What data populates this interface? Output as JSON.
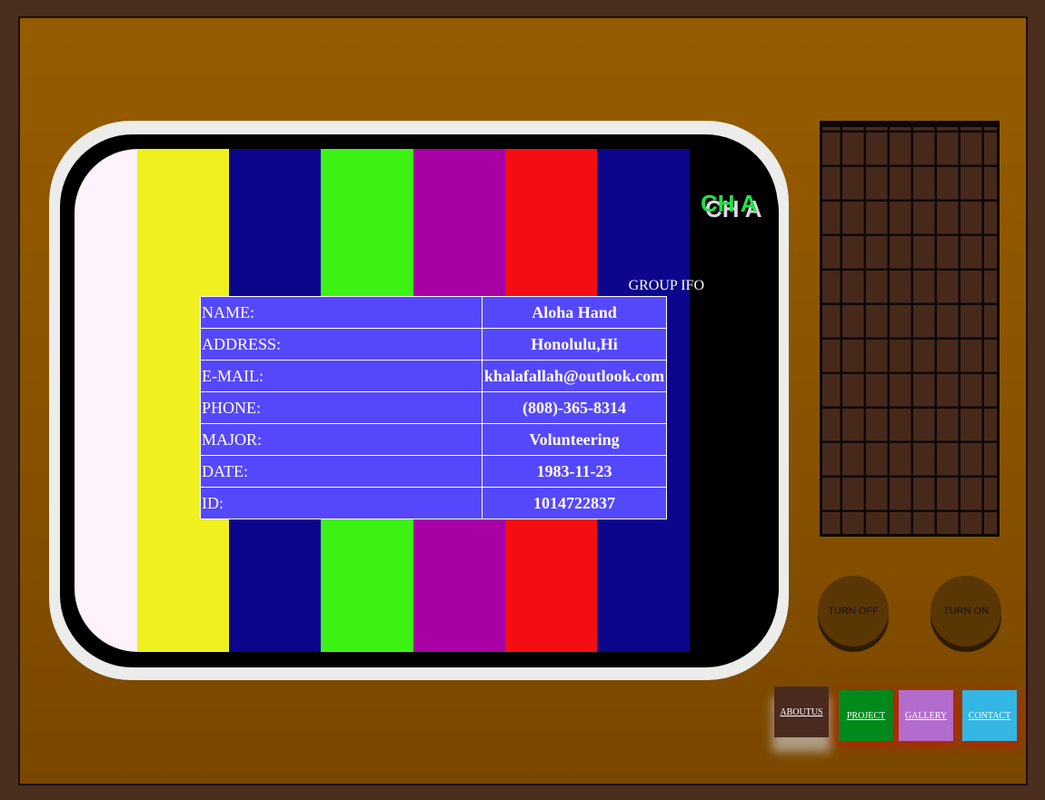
{
  "screen": {
    "channel_label": "CH A",
    "bars": [
      {
        "name": "white-bar",
        "color": "#fff3fb"
      },
      {
        "name": "yellow-bar",
        "color": "#f0f01e"
      },
      {
        "name": "navy-bar",
        "color": "#0b068c"
      },
      {
        "name": "green-bar",
        "color": "#3cf214"
      },
      {
        "name": "purple-bar",
        "color": "#a800a4"
      },
      {
        "name": "red-bar",
        "color": "#f40e14"
      },
      {
        "name": "navy-bar-2",
        "color": "#0b068c"
      },
      {
        "name": "black-bar",
        "color": "#000000"
      }
    ]
  },
  "group_info": {
    "title": "GROUP IFO",
    "rows": [
      {
        "label": "NAME:",
        "value": "Aloha Hand"
      },
      {
        "label": "ADDRESS:",
        "value": "Honolulu,Hi"
      },
      {
        "label": "E-MAIL:",
        "value": "khalafallah@outlook.com"
      },
      {
        "label": "PHONE:",
        "value": "(808)-365-8314"
      },
      {
        "label": "MAJOR:",
        "value": "Volunteering"
      },
      {
        "label": "DATE:",
        "value": "1983-11-23"
      },
      {
        "label": "ID:",
        "value": "1014722837"
      }
    ]
  },
  "controls": {
    "turn_off": "TURN OFF",
    "turn_on": "TURN ON"
  },
  "nav": {
    "about": "ABOUTUS",
    "project": "PROJECT",
    "gallery": "GALLERY",
    "contact": "CONTACT"
  },
  "colors": {
    "cabinet": "#8c5400",
    "table_bg": "#5548fc",
    "channel_green": "#22e04a"
  }
}
